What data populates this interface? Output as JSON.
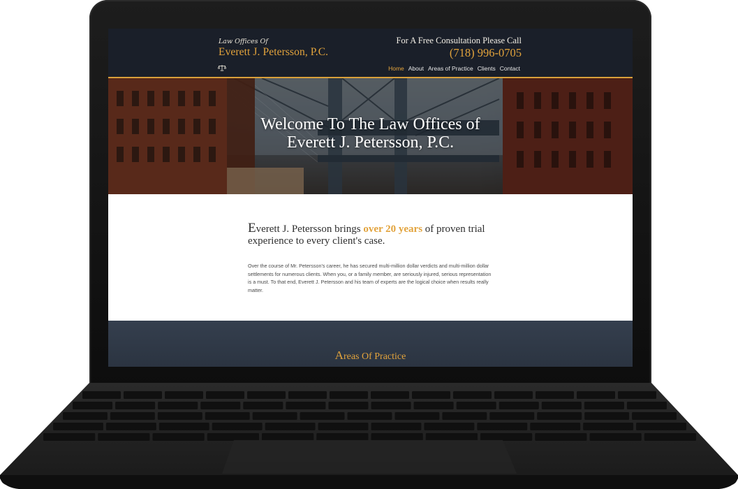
{
  "header": {
    "logo_line1": "Law Offices Of",
    "logo_line2": "Everett J. Petersson, P.C.",
    "logo_icon": "scales-icon",
    "cta_label": "For A Free Consultation Please Call",
    "phone": "(718) 996-0705"
  },
  "nav": {
    "items": [
      {
        "label": "Home",
        "active": true
      },
      {
        "label": "About"
      },
      {
        "label": "Areas of Practice"
      },
      {
        "label": "Clients"
      },
      {
        "label": "Contact"
      }
    ]
  },
  "hero": {
    "title_line1": "Welcome To The Law Offices of",
    "title_line2": "Everett J. Petersson, P.C."
  },
  "intro": {
    "heading_cap": "E",
    "heading_part1": "verett J. Petersson brings ",
    "heading_highlight": "over 20 years",
    "heading_part2": " of proven trial experience to every client's case.",
    "body": "Over the course of Mr. Petersson's career, he has secured multi-million dollar verdicts and multi-million dollar settlements for numerous clients. When you, or a family member, are seriously injured, serious representation is a must. To that end, Everett J. Petersson and his team of experts are the logical choice when results really matter."
  },
  "areas": {
    "title_cap": "A",
    "title_rest": "reas Of Practice"
  },
  "colors": {
    "accent": "#e2a33c",
    "header_bg": "#1a1f29",
    "areas_bg": "#2f3846"
  }
}
